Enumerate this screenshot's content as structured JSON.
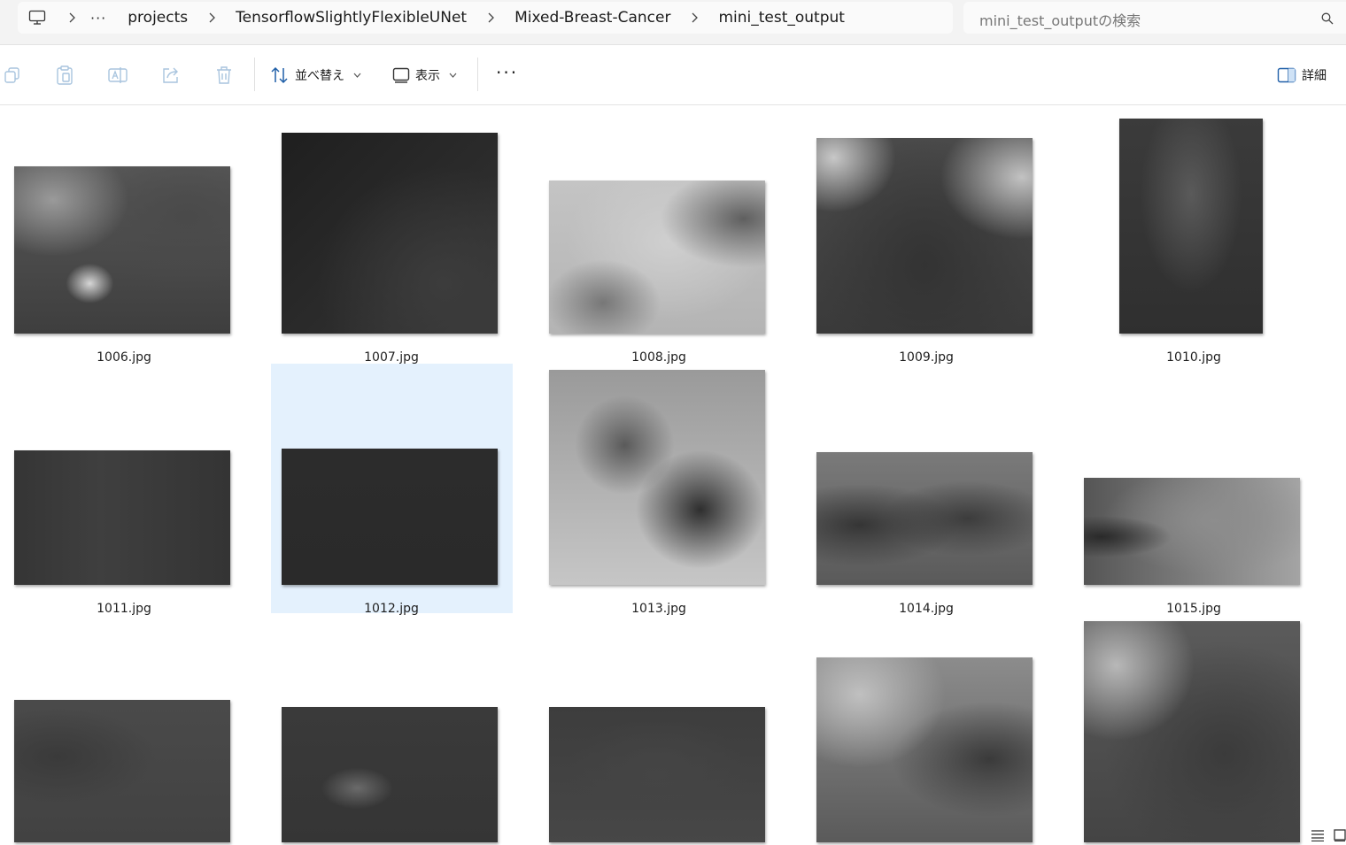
{
  "address_bar": {
    "breadcrumbs": [
      "projects",
      "TensorflowSlightlyFlexibleUNet",
      "Mixed-Breast-Cancer",
      "mini_test_output"
    ],
    "overflow": "···",
    "search_placeholder": "mini_test_outputの検索"
  },
  "toolbar": {
    "sort_label": "並べ替え",
    "view_label": "表示",
    "details_label": "詳細",
    "more": "···"
  },
  "files": [
    {
      "name": "1006.jpg",
      "selected": false
    },
    {
      "name": "1007.jpg",
      "selected": false
    },
    {
      "name": "1008.jpg",
      "selected": false
    },
    {
      "name": "1009.jpg",
      "selected": false
    },
    {
      "name": "1010.jpg",
      "selected": false
    },
    {
      "name": "1011.jpg",
      "selected": false
    },
    {
      "name": "1012.jpg",
      "selected": true
    },
    {
      "name": "1013.jpg",
      "selected": false
    },
    {
      "name": "1014.jpg",
      "selected": false
    },
    {
      "name": "1015.jpg",
      "selected": false
    },
    {
      "name": "",
      "selected": false
    },
    {
      "name": "",
      "selected": false
    },
    {
      "name": "",
      "selected": false
    },
    {
      "name": "",
      "selected": false
    },
    {
      "name": "",
      "selected": false
    }
  ],
  "colors": {
    "selection": "#e4f1fd",
    "accent": "#0067c0"
  }
}
